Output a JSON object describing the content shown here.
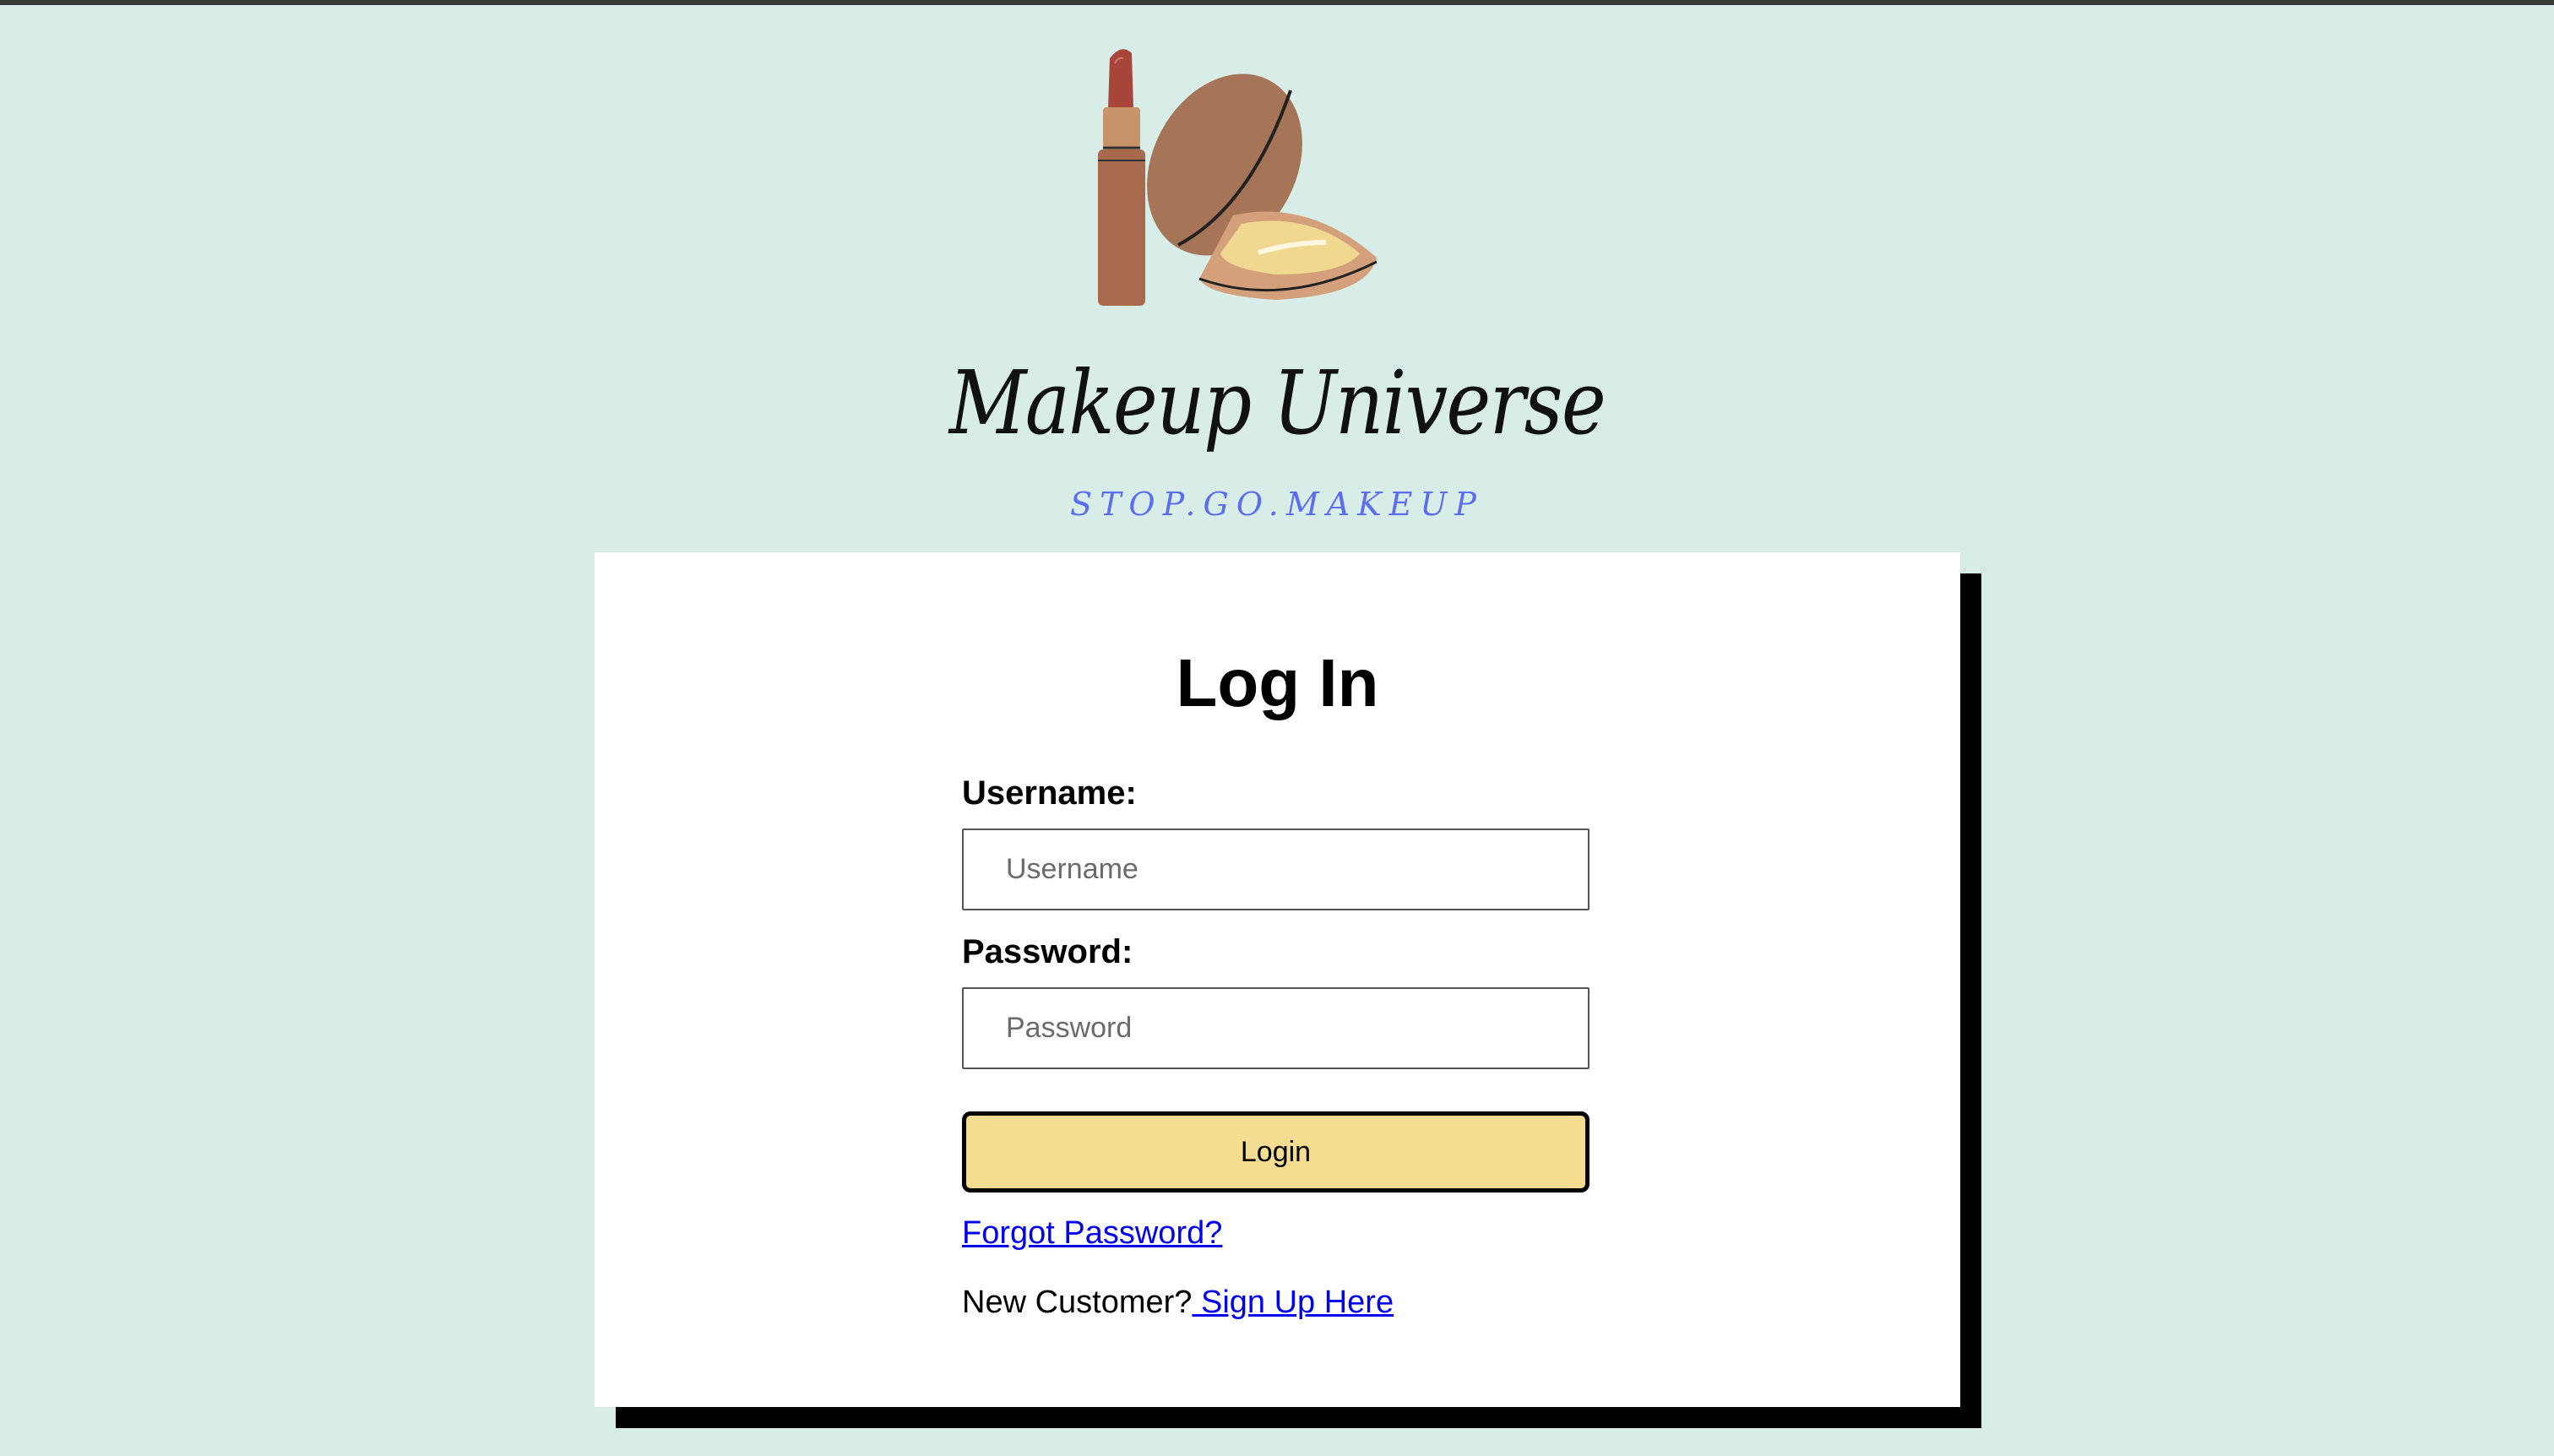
{
  "brand": {
    "name": "Makeup Universe",
    "tagline": "STOP.GO.MAKEUP"
  },
  "logo": {
    "icons": [
      "lipstick-icon",
      "compact-powder-icon"
    ]
  },
  "login_card": {
    "title": "Log In",
    "username": {
      "label": "Username:",
      "placeholder": "Username",
      "value": ""
    },
    "password": {
      "label": "Password:",
      "placeholder": "Password",
      "value": ""
    },
    "login_button_label": "Login",
    "forgot_password_link": "Forgot Password?",
    "new_customer_text": "New Customer?",
    "signup_link": " Sign Up Here"
  },
  "colors": {
    "page_background": "#d8ece8",
    "tagline": "#5b6ef0",
    "button_background": "#f4dc91",
    "link": "#0000ee",
    "card_shadow": "#000000"
  }
}
